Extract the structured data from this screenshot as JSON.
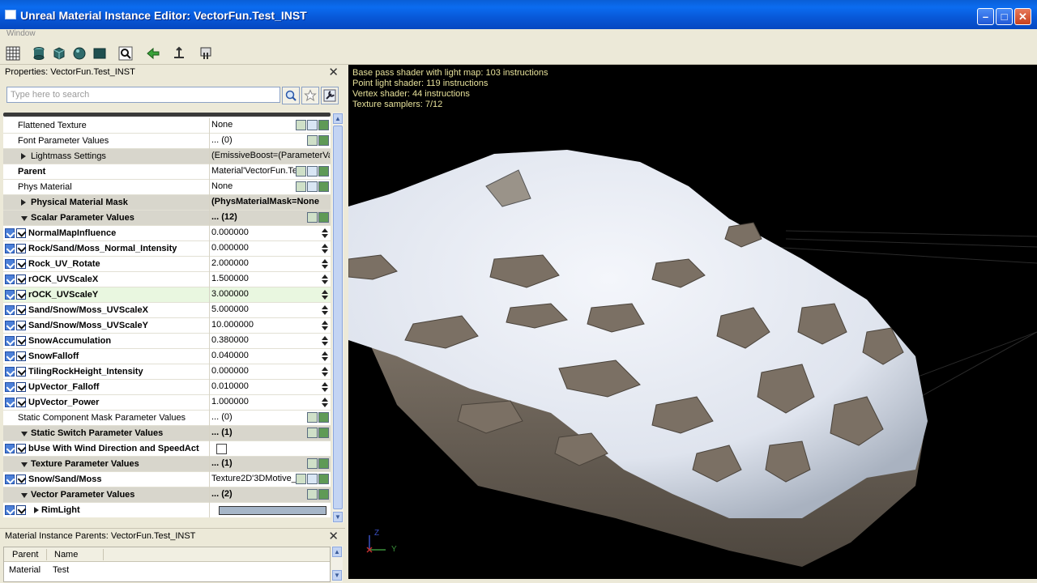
{
  "window": {
    "title": "Unreal Material Instance Editor: VectorFun.Test_INST"
  },
  "menu": {
    "items": [
      "Window"
    ]
  },
  "toolbar": {
    "icons": [
      "grid-icon",
      "cylinder-icon",
      "cube-icon",
      "sphere-icon",
      "plane-icon",
      "zoom-fit-icon",
      "back-arrow-icon",
      "pivot-icon",
      "material-icon"
    ]
  },
  "properties": {
    "title": "Properties: VectorFun.Test_INST",
    "search_placeholder": "Type here to search",
    "rows": [
      {
        "kind": "plain",
        "name": "Flattened Texture",
        "value": "None",
        "icons": 3
      },
      {
        "kind": "plain",
        "name": "Font Parameter Values",
        "value": "... (0)",
        "icons": 2
      },
      {
        "kind": "cat-collapsed",
        "name": "Lightmass Settings",
        "value": "(EmissiveBoost=(ParameterVa"
      },
      {
        "kind": "bold",
        "name": "Parent",
        "value": "Material'VectorFun.Te",
        "icons": 3
      },
      {
        "kind": "plain",
        "name": "Phys Material",
        "value": "None",
        "icons": 3
      },
      {
        "kind": "cat-collapsed-bold",
        "name": "Physical Material Mask",
        "value": "(PhysMaterialMask=None"
      },
      {
        "kind": "cat-expanded",
        "name": "Scalar Parameter Values",
        "value": "... (12)",
        "icons": 2
      },
      {
        "kind": "param",
        "name": "NormalMapInfluence",
        "value": "0.000000"
      },
      {
        "kind": "param",
        "name": "Rock/Sand/Moss_Normal_Intensity",
        "value": "0.000000"
      },
      {
        "kind": "param",
        "name": "Rock_UV_Rotate",
        "value": "2.000000"
      },
      {
        "kind": "param",
        "name": "rOCK_UVScaleX",
        "value": "1.500000"
      },
      {
        "kind": "param-hl",
        "name": "rOCK_UVScaleY",
        "value": "3.000000"
      },
      {
        "kind": "param",
        "name": "Sand/Snow/Moss_UVScaleX",
        "value": "5.000000"
      },
      {
        "kind": "param",
        "name": "Sand/Snow/Moss_UVScaleY",
        "value": "10.000000"
      },
      {
        "kind": "param",
        "name": "SnowAccumulation",
        "value": "0.380000"
      },
      {
        "kind": "param",
        "name": "SnowFalloff",
        "value": "0.040000"
      },
      {
        "kind": "param",
        "name": "TilingRockHeight_Intensity",
        "value": "0.000000"
      },
      {
        "kind": "param",
        "name": "UpVector_Falloff",
        "value": "0.010000"
      },
      {
        "kind": "param",
        "name": "UpVector_Power",
        "value": "1.000000"
      },
      {
        "kind": "plain",
        "name": "Static Component Mask Parameter Values",
        "value": "... (0)",
        "icons": 2
      },
      {
        "kind": "cat-expanded",
        "name": "Static Switch Parameter Values",
        "value": "... (1)",
        "icons": 2
      },
      {
        "kind": "param-bool",
        "name": "bUse With Wind Direction and SpeedAct",
        "value": ""
      },
      {
        "kind": "cat-expanded",
        "name": "Texture Parameter Values",
        "value": "... (1)",
        "icons": 2
      },
      {
        "kind": "param-tex",
        "name": "Snow/Sand/Moss",
        "value": "Texture2D'3DMotive_",
        "icons": 3
      },
      {
        "kind": "cat-expanded",
        "name": "Vector Parameter Values",
        "value": "... (2)",
        "icons": 2
      },
      {
        "kind": "param-color",
        "name": "RimLight",
        "value": ""
      }
    ]
  },
  "parents_panel": {
    "title": "Material Instance Parents: VectorFun.Test_INST",
    "columns": [
      "Parent",
      "Name"
    ],
    "rows": [
      {
        "parent": "Material",
        "name": "Test"
      }
    ]
  },
  "viewport": {
    "stats": [
      "Base pass shader with light map: 103 instructions",
      "Point light shader: 119 instructions",
      "Vertex shader: 44 instructions",
      "Texture samplers: 7/12"
    ],
    "axis_labels": {
      "z": "Z",
      "y": "Y"
    }
  },
  "colors": {
    "titlebar": "#0b6cf0",
    "stats_text": "#e6e09a",
    "rimlight": "#a6b6c8",
    "snow": "#eef1f6",
    "rock": "#7a6f62"
  }
}
